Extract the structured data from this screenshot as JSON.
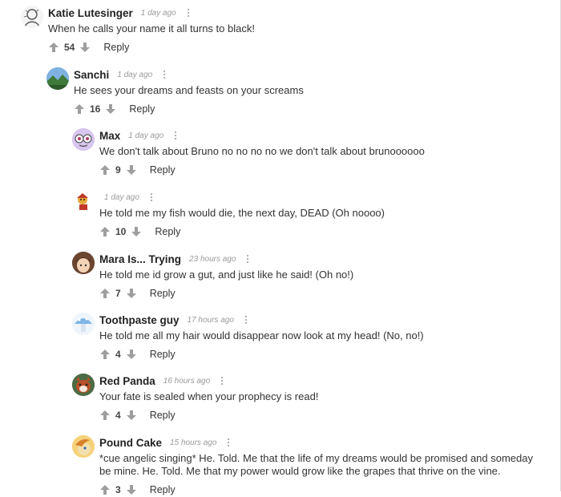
{
  "colors": {
    "vote_icon": "#9e9e9e",
    "time": "#999999",
    "author": "#222222"
  },
  "comments": [
    {
      "author": "Katie Lutesinger",
      "time": "1 day ago",
      "text": "When he calls your name it all turns to black!",
      "votes": "54",
      "reply": "Reply",
      "avatar": "sketch-avatar"
    },
    {
      "author": "Sanchi",
      "time": "1 day ago",
      "text": "He sees your dreams and feasts on your screams",
      "votes": "16",
      "reply": "Reply",
      "avatar": "landscape-avatar"
    },
    {
      "author": "Max",
      "time": "1 day ago",
      "text": "We don't talk about Bruno no no no no we don't talk about brunoooooo",
      "votes": "9",
      "reply": "Reply",
      "avatar": "cartoon-face-avatar"
    },
    {
      "author": "",
      "time": "1 day ago",
      "text": "He told me my fish would die, the next day, DEAD (Oh noooo)",
      "votes": "10",
      "reply": "Reply",
      "avatar": "cartoon-character-avatar"
    },
    {
      "author": "Mara Is... Trying",
      "time": "23 hours ago",
      "text": "He told me id grow a gut, and just like he said! (Oh no!)",
      "votes": "7",
      "reply": "Reply",
      "avatar": "anime-avatar"
    },
    {
      "author": "Toothpaste guy",
      "time": "17 hours ago",
      "text": "He told me all my hair would disappear now look at my head! (No, no!)",
      "votes": "4",
      "reply": "Reply",
      "avatar": "mushroom-avatar"
    },
    {
      "author": "Red Panda",
      "time": "16 hours ago",
      "text": "Your fate is sealed when your prophecy is read!",
      "votes": "4",
      "reply": "Reply",
      "avatar": "red-panda-avatar"
    },
    {
      "author": "Pound Cake",
      "time": "15 hours ago",
      "text": "*cue angelic singing* He. Told. Me that the life of my dreams would be promised and someday be mine. He. Told. Me that my power would grow like the grapes that thrive on the vine.",
      "votes": "3",
      "reply": "Reply",
      "avatar": "pony-avatar"
    }
  ]
}
